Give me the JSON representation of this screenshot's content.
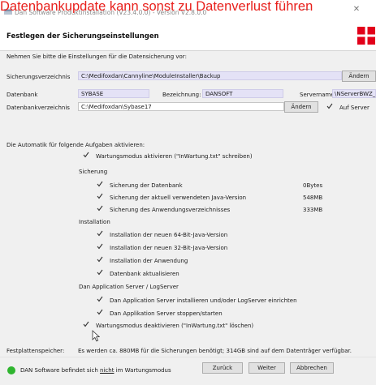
{
  "overlay_text": "Datenbankupdate kann sonst zu Datenverlust führen",
  "window": {
    "title": "Dan Software Produktinstallation (V23.4.0.0) - Version V2.8.0.0",
    "minimize": "—",
    "close": "✕"
  },
  "header": {
    "title": "Festlegen der Sicherungseinstellungen",
    "logo_color": "#e2001a"
  },
  "intro": "Nehmen Sie bitte die Einstellungen für die Datensicherung vor:",
  "backup": {
    "dir_label": "Sicherungsverzeichnis",
    "dir_value": "C:\\Medifoxdan\\Cannyline\\ModuleInstaller\\Backup",
    "change_label": "Ändern"
  },
  "database": {
    "label": "Datenbank",
    "value": "SYBASE",
    "designation_label": "Bezeichnung:",
    "designation_value": "DANSOFT",
    "servername_label": "Servername:",
    "servername_value": "\\NServerBWZ_C",
    "dir_label": "Datenbankverzeichnis",
    "dir_value": "C:\\Medifoxdan\\Sybase17",
    "change_label": "Ändern",
    "on_server_label": "Auf Server",
    "on_server_checked": true
  },
  "automation": {
    "heading": "Die Automatik für folgende Aufgaben aktivieren:",
    "maintenance_on": "Wartungsmodus aktivieren (\"InWartung.txt\" schreiben)",
    "groups": [
      {
        "title": "Sicherung",
        "items": [
          {
            "label": "Sicherung der Datenbank",
            "size": "0Bytes"
          },
          {
            "label": "Sicherung der aktuell verwendeten Java-Version",
            "size": "548MB"
          },
          {
            "label": "Sicherung des Anwendungsverzeichnisses",
            "size": "333MB"
          }
        ]
      },
      {
        "title": "Installation",
        "items": [
          {
            "label": "Installation der neuen 64-Bit-Java-Version"
          },
          {
            "label": "Installation der neuen 32-Bit-Java-Version"
          },
          {
            "label": "Installation der Anwendung"
          },
          {
            "label": "Datenbank aktualisieren"
          }
        ]
      },
      {
        "title": "Dan Application Server / LogServer",
        "items": [
          {
            "label": "Dan Application Server installieren und/oder LogServer einrichten"
          },
          {
            "label": "Dan Applikation Server stoppen/starten"
          }
        ]
      }
    ],
    "maintenance_off": "Wartungsmodus deaktivieren (\"InWartung.txt\" löschen)"
  },
  "disk": {
    "label": "Festplattenspeicher:",
    "text": "Es werden ca. 880MB für die Sicherungen benötigt; 314GB sind auf dem Datenträger verfügbar."
  },
  "status": {
    "pre": "DAN Software befindet sich ",
    "underlined": "nicht",
    "post": " im Wartungsmodus",
    "color": "#2fb52f"
  },
  "buttons": {
    "back": "Zurück",
    "next": "Weiter",
    "cancel": "Abbrechen"
  }
}
